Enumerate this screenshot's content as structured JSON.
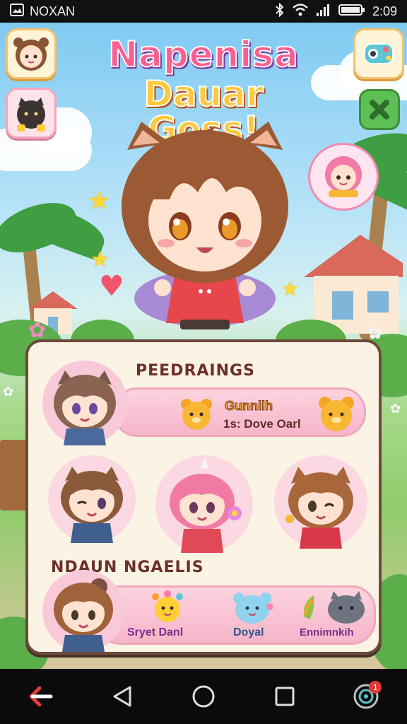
{
  "status_bar": {
    "carrier": "NOXAN",
    "time": "2:09",
    "icons": [
      "screenshot-icon",
      "bluetooth-icon",
      "wifi-icon",
      "signal-icon",
      "battery-icon"
    ]
  },
  "title": {
    "line1": "Napenisa",
    "line2": "Dauar Goss!"
  },
  "sections": {
    "first": {
      "title": "PEEDRAINGS",
      "pill_name": "Gunnilh",
      "pill_sub": "1s: Dove Oarl"
    },
    "second": {
      "title": "NDAUN NGAELIS",
      "pets": [
        "Sryet Danl",
        "Doyal",
        "Ennimnkih"
      ]
    }
  },
  "nav": {
    "badge_count": "1"
  },
  "colors": {
    "accent_pink": "#f6b5c9",
    "panel_border": "#6b4a3b",
    "panel_bg": "#fbf3e3",
    "title_pink": "#ff5e91",
    "title_yellow": "#ffc83d"
  }
}
